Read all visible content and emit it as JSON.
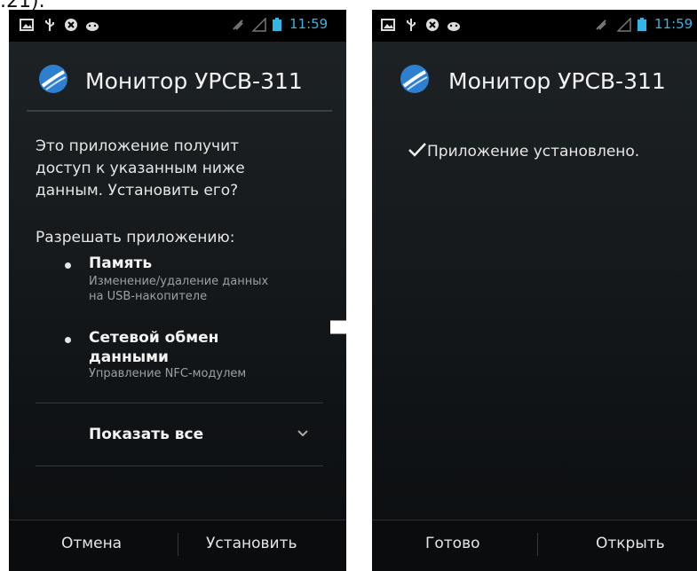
{
  "caption": ".21).",
  "left_screen": {
    "status": {
      "time": "11:59"
    },
    "app_title": "Монитор УРСВ-311",
    "intro": [
      "Это приложение получит",
      "доступ к указанным ниже",
      "данным. Установить его?"
    ],
    "allow_label": "Разрешать приложению:",
    "permissions": [
      {
        "title": "Память",
        "desc": [
          "Изменение/удаление данных",
          "на USB-накопителе"
        ]
      },
      {
        "title_lines": [
          "Сетевой обмен",
          "данными"
        ],
        "desc": [
          "Управление NFC-модулем"
        ]
      }
    ],
    "show_all": "Показать все",
    "buttons": {
      "cancel": "Отмена",
      "install": "Установить"
    }
  },
  "right_screen": {
    "status": {
      "time": "11:59"
    },
    "app_title": "Монитор УРСВ-311",
    "installed_msg": "Приложение установлено.",
    "buttons": {
      "done": "Готово",
      "open": "Открыть"
    }
  },
  "colors": {
    "accent": "#35b5e5",
    "logo": "#2f7fd0",
    "background": "#161a1d"
  }
}
